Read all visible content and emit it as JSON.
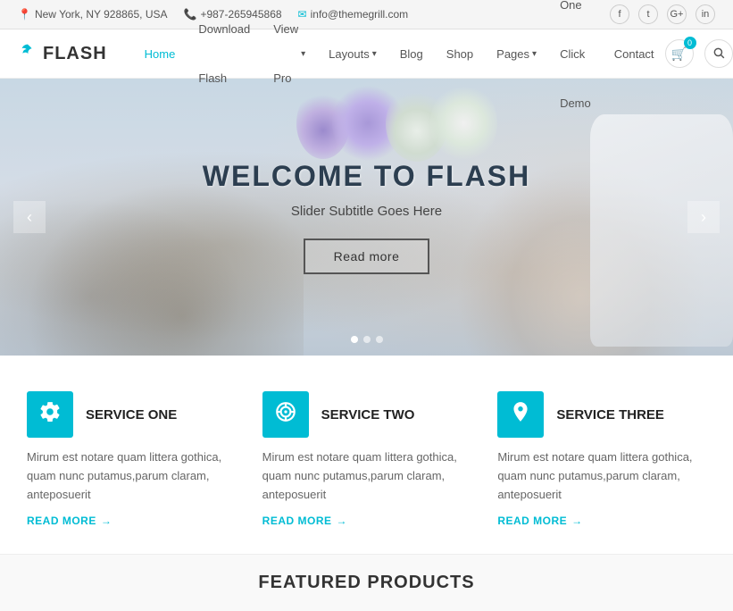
{
  "topbar": {
    "location": "New York, NY 928865, USA",
    "phone": "+987-265945868",
    "email": "info@themegrill.com",
    "location_icon": "📍",
    "phone_icon": "📞",
    "email_icon": "✉",
    "socials": [
      "f",
      "t",
      "G+",
      "in"
    ]
  },
  "navbar": {
    "logo_text": "FLASH",
    "logo_icon": "🐦",
    "links": [
      {
        "label": "Home",
        "active": true,
        "has_dropdown": false
      },
      {
        "label": "Download Flash",
        "active": false,
        "has_dropdown": false
      },
      {
        "label": "View Pro",
        "active": false,
        "has_dropdown": true
      },
      {
        "label": "Layouts",
        "active": false,
        "has_dropdown": true
      },
      {
        "label": "Blog",
        "active": false,
        "has_dropdown": false
      },
      {
        "label": "Shop",
        "active": false,
        "has_dropdown": false
      },
      {
        "label": "Pages",
        "active": false,
        "has_dropdown": true
      },
      {
        "label": "One Click Demo",
        "active": false,
        "has_dropdown": false
      },
      {
        "label": "Contact",
        "active": false,
        "has_dropdown": false
      }
    ],
    "cart_count": "0",
    "search_icon": "🔍"
  },
  "hero": {
    "title": "WELCOME TO FLASH",
    "subtitle": "Slider Subtitle Goes Here",
    "cta_label": "Read more",
    "dots": [
      true,
      false,
      false
    ],
    "arrow_left": "‹",
    "arrow_right": "›"
  },
  "services": [
    {
      "icon": "⚙",
      "title": "SERVICE ONE",
      "text": "Mirum est notare quam littera gothica, quam nunc putamus,parum claram, anteposuerit",
      "link_label": "READ MORE",
      "link_arrow": "→"
    },
    {
      "icon": "🎯",
      "title": "SERVICE TWO",
      "text": "Mirum est notare quam littera gothica, quam nunc putamus,parum claram, anteposuerit",
      "link_label": "READ MORE",
      "link_arrow": "→"
    },
    {
      "icon": "📍",
      "title": "SERVICE THREE",
      "text": "Mirum est notare quam littera gothica, quam nunc putamus,parum claram, anteposuerit",
      "link_label": "READ MORE",
      "link_arrow": "→"
    }
  ],
  "featured": {
    "title": "FEATURED PRODUCTS"
  }
}
